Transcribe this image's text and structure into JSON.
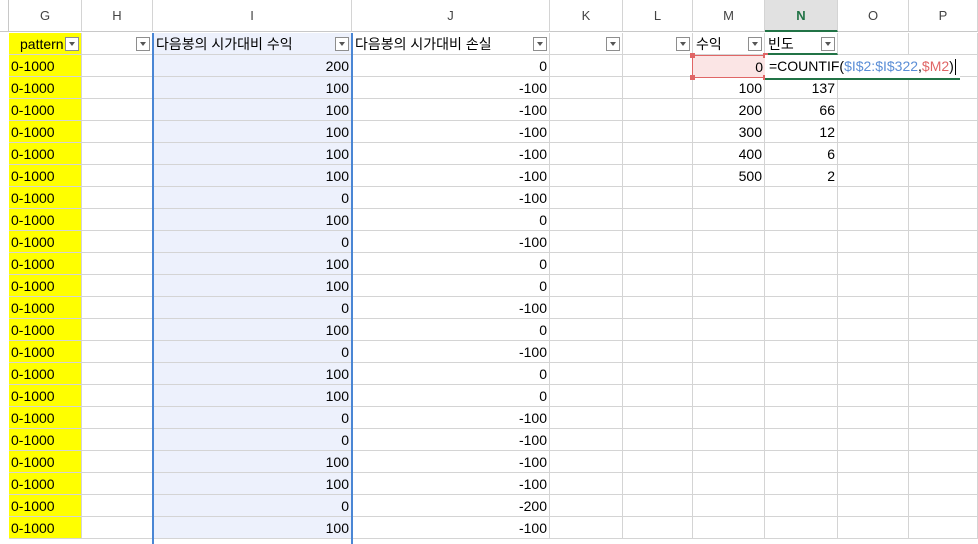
{
  "columns": [
    "G",
    "H",
    "I",
    "J",
    "K",
    "L",
    "M",
    "N",
    "O",
    "P"
  ],
  "selected_column": "N",
  "header_row": {
    "G": "pattern",
    "I": "다음봉의 시가대비 수익",
    "J": "다음봉의 시가대비 손실",
    "M": "수익",
    "N": "빈도"
  },
  "rows": [
    {
      "g": "0-1000",
      "i": "200",
      "j": "0"
    },
    {
      "g": "0-1000",
      "i": "100",
      "j": "-100"
    },
    {
      "g": "0-1000",
      "i": "100",
      "j": "-100"
    },
    {
      "g": "0-1000",
      "i": "100",
      "j": "-100"
    },
    {
      "g": "0-1000",
      "i": "100",
      "j": "-100"
    },
    {
      "g": "0-1000",
      "i": "100",
      "j": "-100"
    },
    {
      "g": "0-1000",
      "i": "0",
      "j": "-100"
    },
    {
      "g": "0-1000",
      "i": "100",
      "j": "0"
    },
    {
      "g": "0-1000",
      "i": "0",
      "j": "-100"
    },
    {
      "g": "0-1000",
      "i": "100",
      "j": "0"
    },
    {
      "g": "0-1000",
      "i": "100",
      "j": "0"
    },
    {
      "g": "0-1000",
      "i": "0",
      "j": "-100"
    },
    {
      "g": "0-1000",
      "i": "100",
      "j": "0"
    },
    {
      "g": "0-1000",
      "i": "0",
      "j": "-100"
    },
    {
      "g": "0-1000",
      "i": "100",
      "j": "0"
    },
    {
      "g": "0-1000",
      "i": "100",
      "j": "0"
    },
    {
      "g": "0-1000",
      "i": "0",
      "j": "-100"
    },
    {
      "g": "0-1000",
      "i": "0",
      "j": "-100"
    },
    {
      "g": "0-1000",
      "i": "100",
      "j": "-100"
    },
    {
      "g": "0-1000",
      "i": "100",
      "j": "-100"
    },
    {
      "g": "0-1000",
      "i": "0",
      "j": "-200"
    },
    {
      "g": "0-1000",
      "i": "100",
      "j": "-100"
    }
  ],
  "freq_table": [
    {
      "m": "0",
      "n": ""
    },
    {
      "m": "100",
      "n": "137"
    },
    {
      "m": "200",
      "n": "66"
    },
    {
      "m": "300",
      "n": "12"
    },
    {
      "m": "400",
      "n": "6"
    },
    {
      "m": "500",
      "n": "2"
    }
  ],
  "formula": {
    "prefix": "=COUNTIF(",
    "range_ref": "$I$2:$I$322",
    "sep": ",",
    "criteria_ref": "$M2",
    "suffix": ")"
  },
  "colors": {
    "pattern_fill": "#ffff00",
    "selection_blue": "#4a86d4",
    "ref_red": "#e06666",
    "excel_green": "#217346"
  }
}
